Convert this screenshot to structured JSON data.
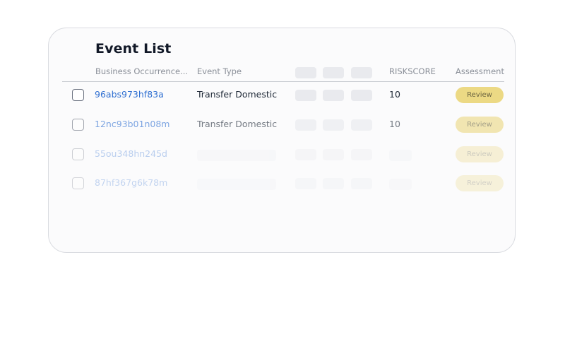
{
  "panel": {
    "title": "Event List"
  },
  "columns": {
    "business_occurrence": "Business Occurrence...",
    "event_type": "Event Type",
    "riskscore": "RISKSCORE",
    "assessment": "Assessment"
  },
  "rows": [
    {
      "id": "96abs973hf83a",
      "event_type": "Transfer Domestic",
      "riskscore": "10",
      "action": "Review"
    },
    {
      "id": "12nc93b01n08m",
      "event_type": "Transfer Domestic",
      "riskscore": "10",
      "action": "Review"
    },
    {
      "id": "55ou348hn245d",
      "action": "Review"
    },
    {
      "id": "87hf367g6k78m",
      "action": "Review"
    }
  ],
  "colors": {
    "link": "#2f6fd1",
    "review_button": "#ecd984",
    "skeleton": "#e9eaee"
  }
}
